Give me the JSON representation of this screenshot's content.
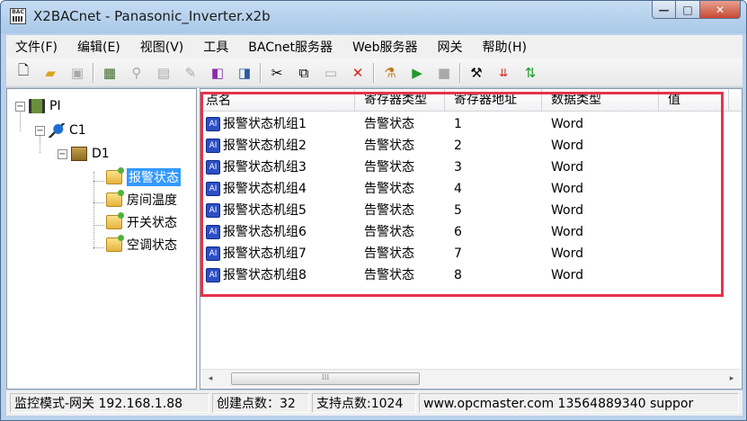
{
  "window": {
    "title": "X2BACnet - Panasonic_Inverter.x2b",
    "icon_text": "BAC",
    "controls": {
      "minimize": "—",
      "maximize": "□",
      "close": "✕"
    }
  },
  "menu": [
    "文件(F)",
    "编辑(E)",
    "视图(V)",
    "工具",
    "BACnet服务器",
    "Web服务器",
    "网关",
    "帮助(H)"
  ],
  "toolbar": {
    "icons": [
      "new-icon",
      "open-icon",
      "save-icon",
      "device-icon",
      "network-icon",
      "page-icon",
      "add-icon",
      "properties-icon",
      "cut-icon",
      "copy-icon",
      "paste-icon",
      "delete-icon",
      "tools-icon",
      "run-icon",
      "stop-icon",
      "settings-icon",
      "load-icon",
      "update-icon"
    ]
  },
  "tree": {
    "root": "PI",
    "channel": "C1",
    "device": "D1",
    "groups": [
      "报警状态",
      "房间温度",
      "开关状态",
      "空调状态"
    ],
    "selected_group": "报警状态",
    "toggle_collapse": "−"
  },
  "grid": {
    "columns": [
      "点名",
      "寄存器类型",
      "寄存器地址",
      "数据类型",
      "值"
    ],
    "rows": [
      {
        "name": "报警状态机组1",
        "reg_type": "告警状态",
        "reg_addr": "1",
        "data_type": "Word",
        "value": ""
      },
      {
        "name": "报警状态机组2",
        "reg_type": "告警状态",
        "reg_addr": "2",
        "data_type": "Word",
        "value": ""
      },
      {
        "name": "报警状态机组3",
        "reg_type": "告警状态",
        "reg_addr": "3",
        "data_type": "Word",
        "value": ""
      },
      {
        "name": "报警状态机组4",
        "reg_type": "告警状态",
        "reg_addr": "4",
        "data_type": "Word",
        "value": ""
      },
      {
        "name": "报警状态机组5",
        "reg_type": "告警状态",
        "reg_addr": "5",
        "data_type": "Word",
        "value": ""
      },
      {
        "name": "报警状态机组6",
        "reg_type": "告警状态",
        "reg_addr": "6",
        "data_type": "Word",
        "value": ""
      },
      {
        "name": "报警状态机组7",
        "reg_type": "告警状态",
        "reg_addr": "7",
        "data_type": "Word",
        "value": ""
      },
      {
        "name": "报警状态机组8",
        "reg_type": "告警状态",
        "reg_addr": "8",
        "data_type": "Word",
        "value": ""
      }
    ],
    "tag_icon_text": "AI",
    "highlight_color": "#e5334b",
    "scroll_left": "◂",
    "scroll_right": "▸",
    "scroll_grip": "⁞⁞⁞"
  },
  "status": {
    "mode": "监控模式-网关 192.168.1.88",
    "created_points": "创建点数：32",
    "supported_points": "支持点数:1024",
    "contact": "www.opcmaster.com 13564889340 suppor"
  },
  "colors": {
    "accent": "#3399ff",
    "title_bg": "#b9d1ea",
    "close_button": "#c74a33"
  }
}
